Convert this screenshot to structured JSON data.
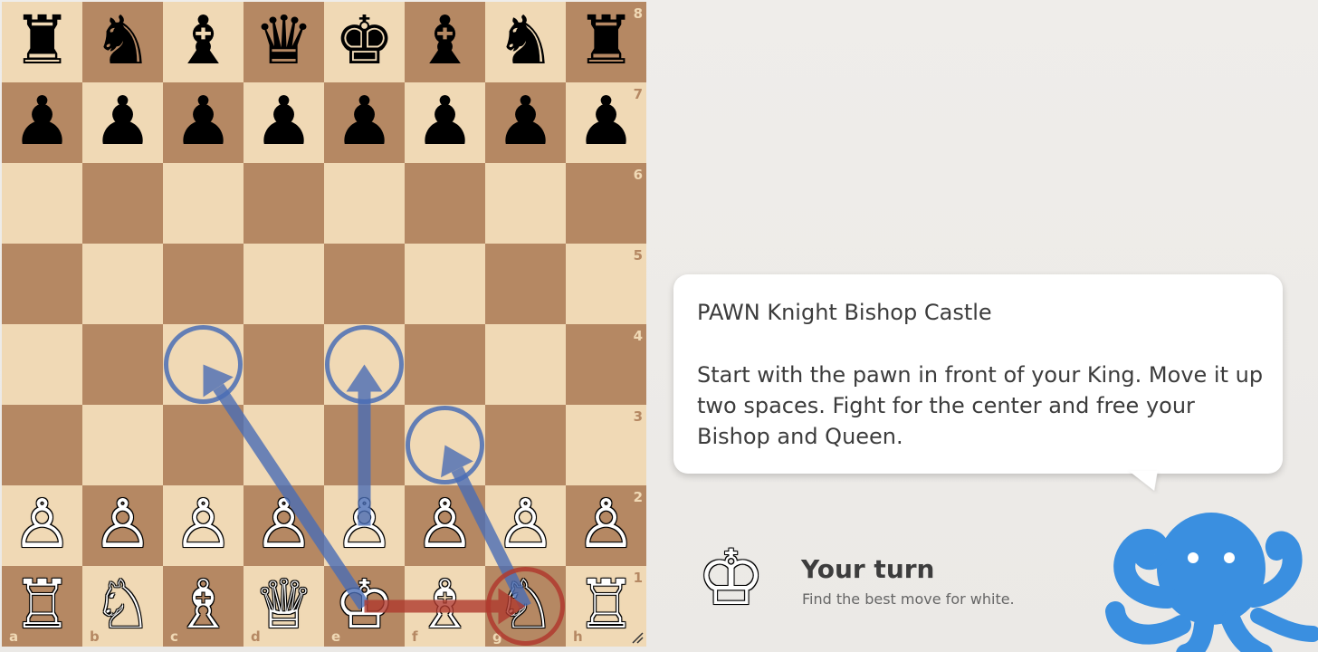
{
  "board": {
    "ranks": [
      [
        "♜",
        "♞",
        "♝",
        "♛",
        "♚",
        "♝",
        "♞",
        "♜"
      ],
      [
        "♟",
        "♟",
        "♟",
        "♟",
        "♟",
        "♟",
        "♟",
        "♟"
      ],
      [
        "",
        "",
        "",
        "",
        "",
        "",
        "",
        ""
      ],
      [
        "",
        "",
        "",
        "",
        "",
        "",
        "",
        ""
      ],
      [
        "",
        "",
        "",
        "",
        "",
        "",
        "",
        ""
      ],
      [
        "",
        "",
        "",
        "",
        "",
        "",
        "",
        ""
      ],
      [
        "♙",
        "♙",
        "♙",
        "♙",
        "♙",
        "♙",
        "♙",
        "♙"
      ],
      [
        "♖",
        "♘",
        "♗",
        "♕",
        "♔",
        "♗",
        "♘",
        "♖"
      ]
    ],
    "piece_colors": [
      [
        "b",
        "b",
        "b",
        "b",
        "b",
        "b",
        "b",
        "b"
      ],
      [
        "b",
        "b",
        "b",
        "b",
        "b",
        "b",
        "b",
        "b"
      ],
      [
        "",
        "",
        "",
        "",
        "",
        "",
        "",
        ""
      ],
      [
        "",
        "",
        "",
        "",
        "",
        "",
        "",
        ""
      ],
      [
        "",
        "",
        "",
        "",
        "",
        "",
        "",
        ""
      ],
      [
        "",
        "",
        "",
        "",
        "",
        "",
        "",
        ""
      ],
      [
        "w",
        "w",
        "w",
        "w",
        "w",
        "w",
        "w",
        "w"
      ],
      [
        "w",
        "w",
        "w",
        "w",
        "w",
        "w",
        "w",
        "w"
      ]
    ],
    "rank_labels": [
      "8",
      "7",
      "6",
      "5",
      "4",
      "3",
      "2",
      "1"
    ],
    "file_labels": [
      "a",
      "b",
      "c",
      "d",
      "e",
      "f",
      "g",
      "h"
    ],
    "colors": {
      "light": "#f0d9b5",
      "dark": "#b58863",
      "hint_blue": "#4a6db5",
      "hint_red": "#b03a2e"
    },
    "hints": [
      {
        "color": "blue",
        "from": "e1",
        "to": "c4",
        "type": "arrow"
      },
      {
        "color": "blue",
        "from": "e2",
        "to": "e4",
        "type": "arrow"
      },
      {
        "color": "blue",
        "from": "g1",
        "to": "f3",
        "type": "arrow"
      },
      {
        "color": "red",
        "from": "e1",
        "to": "g1",
        "type": "arrow"
      },
      {
        "color": "blue",
        "square": "c4",
        "type": "circle"
      },
      {
        "color": "blue",
        "square": "e4",
        "type": "circle"
      },
      {
        "color": "blue",
        "square": "f3",
        "type": "circle"
      },
      {
        "color": "red",
        "square": "g1",
        "type": "circle"
      }
    ]
  },
  "coach": {
    "title": "PAWN Knight Bishop Castle",
    "body": "Start with the pawn in front of your King. Move it up two spaces. Fight for the center and free your Bishop and Queen.",
    "mascot_icon": "octopus-icon",
    "mascot_color": "#3a8fe0"
  },
  "status": {
    "icon": "♔",
    "title": "Your turn",
    "subtitle": "Find the best move for white."
  }
}
